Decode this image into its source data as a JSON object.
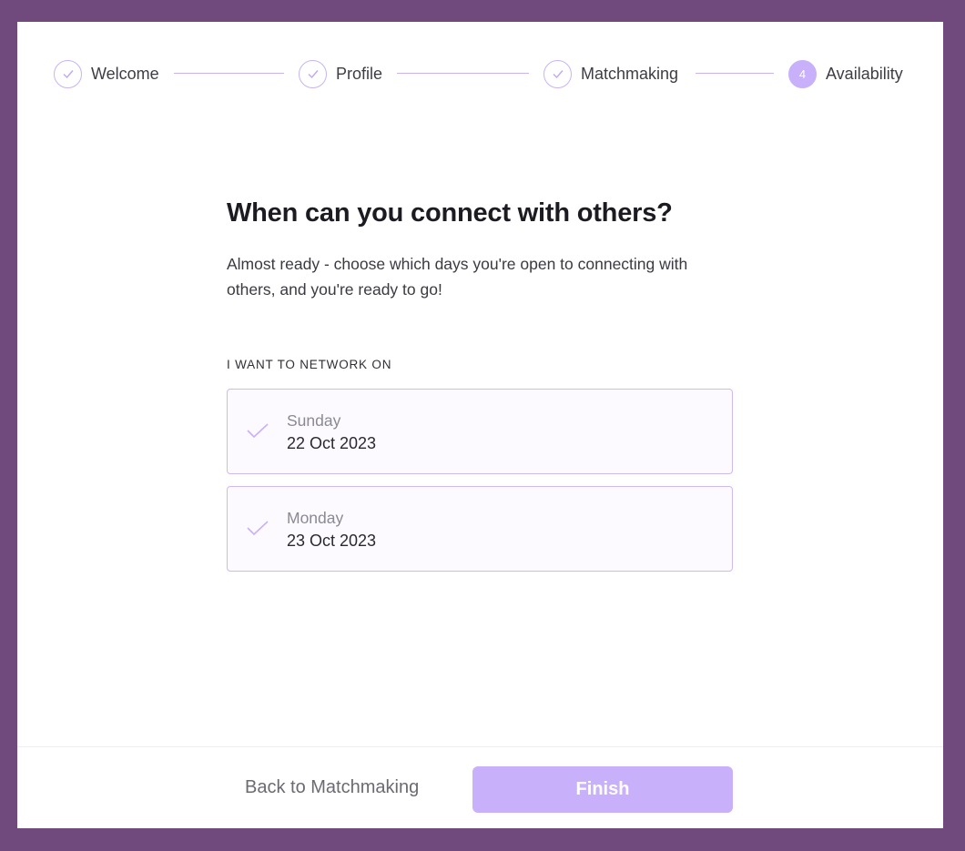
{
  "stepper": {
    "steps": [
      {
        "label": "Welcome",
        "state": "completed"
      },
      {
        "label": "Profile",
        "state": "completed"
      },
      {
        "label": "Matchmaking",
        "state": "completed"
      },
      {
        "label": "Availability",
        "state": "active",
        "number": "4"
      }
    ]
  },
  "main": {
    "title": "When can you connect with others?",
    "subtitle": "Almost ready - choose which days you're open to connecting with others, and you're ready to go!",
    "section_label": "I WANT TO NETWORK ON",
    "days": [
      {
        "weekday": "Sunday",
        "date": "22 Oct 2023"
      },
      {
        "weekday": "Monday",
        "date": "23 Oct 2023"
      }
    ]
  },
  "footer": {
    "back_label": "Back to Matchmaking",
    "finish_label": "Finish"
  },
  "colors": {
    "backdrop": "#704a7d",
    "accent": "#c9b0fa",
    "accent_border": "#c7b4f1"
  },
  "icons": {
    "completed_step": "check-icon",
    "day_option": "check-icon"
  }
}
